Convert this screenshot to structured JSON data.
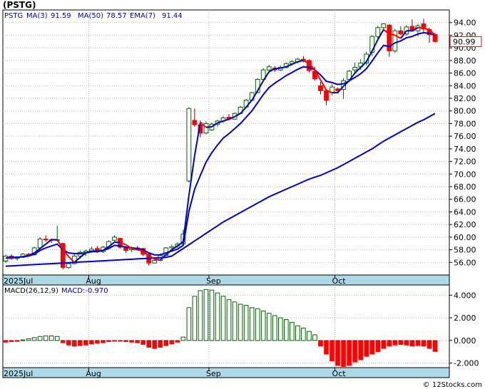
{
  "header": {
    "title": "(PSTG)"
  },
  "footer": {
    "credit": "© 12Stocks.com"
  },
  "colors": {
    "price_panel_bg": "#ffffff",
    "axis_strip": "#add8e6",
    "grid": "#b0b0b0",
    "candle_up": "#006400",
    "candle_down": "#ff0000",
    "ma_line": "#0000cc",
    "ema_line": "#ff0000",
    "macd_pos": "#006400",
    "macd_neg": "#ff0000",
    "price_box_border": "#ff0000"
  },
  "chart_data": [
    {
      "type": "candlestick",
      "legend": {
        "symbol": "PSTG",
        "ma3_label": "MA(3)",
        "ma3_value": "91.59",
        "ma50_label": "MA(50)",
        "ma50_value": "78.57",
        "ema7_label": "EMA(7)",
        "ema7_value": "91.44"
      },
      "last_price_label": "90.99",
      "ylim": [
        54,
        96
      ],
      "yticks": [
        "56.00",
        "58.00",
        "60.00",
        "62.00",
        "64.00",
        "66.00",
        "68.00",
        "70.00",
        "72.00",
        "74.00",
        "76.00",
        "78.00",
        "80.00",
        "82.00",
        "84.00",
        "86.00",
        "88.00",
        "90.00",
        "92.00",
        "94.00"
      ],
      "xticks": [
        {
          "label": "2025Jul",
          "index": 0
        },
        {
          "label": "Aug",
          "index": 15
        },
        {
          "label": "Sep",
          "index": 36
        },
        {
          "label": "Oct",
          "index": 58
        }
      ],
      "candles": [
        [
          56.2,
          57.2,
          55.9,
          57.0
        ],
        [
          57.0,
          57.3,
          56.4,
          56.6
        ],
        [
          56.6,
          57.0,
          56.3,
          56.8
        ],
        [
          56.8,
          57.5,
          56.7,
          57.3
        ],
        [
          57.3,
          57.5,
          56.9,
          57.1
        ],
        [
          57.2,
          58.5,
          57.1,
          58.3
        ],
        [
          58.3,
          60.0,
          58.1,
          59.7
        ],
        [
          59.7,
          60.3,
          59.3,
          59.6
        ],
        [
          59.6,
          59.8,
          59.1,
          59.5
        ],
        [
          59.5,
          61.8,
          59.3,
          59.6
        ],
        [
          59.0,
          59.1,
          54.9,
          55.2
        ],
        [
          55.2,
          56.0,
          55.0,
          55.8
        ],
        [
          55.8,
          57.4,
          55.7,
          57.0
        ],
        [
          57.0,
          57.9,
          56.6,
          57.6
        ],
        [
          57.6,
          58.0,
          57.0,
          57.8
        ],
        [
          57.8,
          58.5,
          57.5,
          58.1
        ],
        [
          58.2,
          58.6,
          57.5,
          57.7
        ],
        [
          57.7,
          58.6,
          57.5,
          58.4
        ],
        [
          58.4,
          59.5,
          58.2,
          59.3
        ],
        [
          59.5,
          60.3,
          59.3,
          60.0
        ],
        [
          59.8,
          59.9,
          58.2,
          58.4
        ],
        [
          58.4,
          58.6,
          57.5,
          57.9
        ],
        [
          58.0,
          58.5,
          57.6,
          58.2
        ],
        [
          58.3,
          58.6,
          57.9,
          58.0
        ],
        [
          58.2,
          58.3,
          57.0,
          57.3
        ],
        [
          57.3,
          57.4,
          55.5,
          55.9
        ],
        [
          55.9,
          56.5,
          55.8,
          56.3
        ],
        [
          56.3,
          57.4,
          56.2,
          57.1
        ],
        [
          57.1,
          58.4,
          57.0,
          58.3
        ],
        [
          58.3,
          58.8,
          58.1,
          58.5
        ],
        [
          58.6,
          59.2,
          58.3,
          58.9
        ],
        [
          58.9,
          61.2,
          58.8,
          60.5
        ],
        [
          68.9,
          80.6,
          68.7,
          80.4
        ],
        [
          78.5,
          80.4,
          77.5,
          77.8
        ],
        [
          77.8,
          78.5,
          75.8,
          76.5
        ],
        [
          76.5,
          78.4,
          76.3,
          78.0
        ],
        [
          77.0,
          78.2,
          76.8,
          77.9
        ],
        [
          77.9,
          78.6,
          77.5,
          78.4
        ],
        [
          78.4,
          79.2,
          78.1,
          78.9
        ],
        [
          79.0,
          79.5,
          78.5,
          78.7
        ],
        [
          78.7,
          79.8,
          78.6,
          79.6
        ],
        [
          79.6,
          80.8,
          79.5,
          80.6
        ],
        [
          80.6,
          81.9,
          80.5,
          81.7
        ],
        [
          81.7,
          83.0,
          81.6,
          82.9
        ],
        [
          82.9,
          85.2,
          82.8,
          85.0
        ],
        [
          85.0,
          86.8,
          84.7,
          86.5
        ],
        [
          86.5,
          87.3,
          86.2,
          87.0
        ],
        [
          86.8,
          87.1,
          86.2,
          86.5
        ],
        [
          86.5,
          87.2,
          86.3,
          86.9
        ],
        [
          86.9,
          87.7,
          86.7,
          87.5
        ],
        [
          87.5,
          88.1,
          87.2,
          87.8
        ],
        [
          87.8,
          88.4,
          87.5,
          88.2
        ],
        [
          88.2,
          88.7,
          87.7,
          88.0
        ],
        [
          88.0,
          88.2,
          86.1,
          86.4
        ],
        [
          86.3,
          87.0,
          84.8,
          85.1
        ],
        [
          84.0,
          84.6,
          82.6,
          83.2
        ],
        [
          83.2,
          83.5,
          80.9,
          81.7
        ],
        [
          82.9,
          84.2,
          82.5,
          83.8
        ],
        [
          83.5,
          83.7,
          82.8,
          83.2
        ],
        [
          83.4,
          85.2,
          81.9,
          84.8
        ],
        [
          85.0,
          86.5,
          84.6,
          86.3
        ],
        [
          86.5,
          87.7,
          85.9,
          86.9
        ],
        [
          87.0,
          88.2,
          86.5,
          87.6
        ],
        [
          87.6,
          89.4,
          87.2,
          89.0
        ],
        [
          89.3,
          92.0,
          88.7,
          91.8
        ],
        [
          91.8,
          93.5,
          91.2,
          93.2
        ],
        [
          93.2,
          93.9,
          92.6,
          93.8
        ],
        [
          93.6,
          93.8,
          88.6,
          89.5
        ],
        [
          89.5,
          93.0,
          89.2,
          92.7
        ],
        [
          92.7,
          93.4,
          92.0,
          92.2
        ],
        [
          92.2,
          93.6,
          91.9,
          93.3
        ],
        [
          93.4,
          94.5,
          92.5,
          92.7
        ],
        [
          92.7,
          93.8,
          91.8,
          93.5
        ],
        [
          93.8,
          94.6,
          92.5,
          93.0
        ],
        [
          92.9,
          93.2,
          90.8,
          92.1
        ],
        [
          92.1,
          92.4,
          90.9,
          91.0
        ]
      ],
      "ma3": [
        56.7,
        56.8,
        56.8,
        56.9,
        57.1,
        57.5,
        58.2,
        58.9,
        59.6,
        59.6,
        58.1,
        56.9,
        56.0,
        56.8,
        57.5,
        57.8,
        57.8,
        57.9,
        58.5,
        59.2,
        59.2,
        58.8,
        58.2,
        58.0,
        57.8,
        57.1,
        56.5,
        56.4,
        57.2,
        58.0,
        58.6,
        59.3,
        66.6,
        72.9,
        78.2,
        77.4,
        77.5,
        78.1,
        78.4,
        78.7,
        79.1,
        79.6,
        80.6,
        81.7,
        83.2,
        84.8,
        86.2,
        86.7,
        86.8,
        87.0,
        87.4,
        87.8,
        88.0,
        87.5,
        86.5,
        84.9,
        83.3,
        82.9,
        82.9,
        83.9,
        84.8,
        86.0,
        86.9,
        87.8,
        89.5,
        91.3,
        92.9,
        92.2,
        92.0,
        91.5,
        92.7,
        92.7,
        93.2,
        93.1,
        92.9,
        92.0
      ],
      "ema7": [
        56.7,
        56.8,
        56.8,
        56.9,
        57.0,
        57.3,
        57.9,
        58.3,
        58.6,
        58.9,
        58.0,
        57.5,
        57.4,
        57.4,
        57.5,
        57.7,
        57.7,
        57.9,
        58.2,
        58.7,
        58.6,
        58.4,
        58.3,
        58.2,
        58.0,
        57.5,
        57.2,
        57.2,
        57.5,
        57.8,
        58.1,
        58.7,
        64.1,
        67.6,
        69.8,
        71.9,
        73.4,
        74.6,
        75.7,
        76.4,
        77.2,
        78.0,
        79.0,
        80.0,
        81.3,
        82.6,
        83.7,
        84.4,
        85.0,
        85.6,
        86.1,
        86.6,
        87.0,
        86.9,
        86.5,
        85.7,
        84.7,
        84.5,
        84.2,
        84.3,
        84.8,
        85.3,
        85.9,
        86.7,
        87.9,
        89.2,
        90.4,
        90.2,
        90.8,
        91.1,
        91.6,
        91.8,
        92.2,
        92.4,
        92.3,
        92.0
      ],
      "ma50": [
        55.4,
        55.45,
        55.5,
        55.55,
        55.6,
        55.65,
        55.7,
        55.75,
        55.8,
        55.85,
        55.9,
        55.95,
        56.0,
        56.05,
        56.1,
        56.15,
        56.2,
        56.25,
        56.3,
        56.35,
        56.4,
        56.45,
        56.5,
        56.55,
        56.6,
        56.65,
        56.7,
        56.75,
        56.8,
        57.0,
        57.6,
        58.2,
        58.8,
        59.4,
        60.0,
        60.6,
        61.2,
        61.8,
        62.4,
        62.9,
        63.4,
        63.9,
        64.4,
        64.9,
        65.4,
        65.9,
        66.4,
        66.8,
        67.2,
        67.6,
        68.0,
        68.4,
        68.8,
        69.2,
        69.5,
        69.8,
        70.2,
        70.6,
        71.0,
        71.5,
        72.0,
        72.5,
        73.0,
        73.5,
        74.0,
        74.6,
        75.2,
        75.7,
        76.2,
        76.7,
        77.2,
        77.7,
        78.2,
        78.6,
        79.1,
        79.6
      ]
    },
    {
      "type": "bar",
      "legend": {
        "label": "MACD(26,12,9)",
        "value_label": "MACD:-0.970"
      },
      "ylim": [
        -2.4,
        4.9
      ],
      "yticks": [
        "-2.000",
        "0.000",
        "2.000",
        "4.000"
      ],
      "values": [
        -0.15,
        -0.1,
        -0.08,
        0.05,
        0.15,
        0.25,
        0.35,
        0.4,
        0.4,
        0.35,
        -0.2,
        -0.4,
        -0.5,
        -0.45,
        -0.4,
        -0.3,
        -0.25,
        -0.2,
        -0.1,
        -0.05,
        -0.05,
        -0.1,
        -0.15,
        -0.2,
        -0.35,
        -0.6,
        -0.7,
        -0.6,
        -0.45,
        -0.3,
        -0.15,
        0.3,
        2.9,
        3.9,
        4.4,
        4.5,
        4.45,
        4.2,
        3.9,
        3.6,
        3.4,
        3.2,
        3.1,
        2.9,
        2.8,
        2.6,
        2.4,
        2.2,
        2.0,
        1.85,
        1.6,
        1.3,
        1.1,
        0.8,
        0.5,
        -0.5,
        -1.2,
        -1.8,
        -2.2,
        -2.3,
        -2.2,
        -1.9,
        -1.7,
        -1.4,
        -1.2,
        -1.0,
        -0.7,
        -0.5,
        -0.4,
        -0.35,
        -0.4,
        -0.5,
        -0.45,
        -0.5,
        -0.7,
        -0.97
      ],
      "xticks": [
        {
          "label": "2025Jul",
          "index": 0
        },
        {
          "label": "Aug",
          "index": 15
        },
        {
          "label": "Sep",
          "index": 36
        },
        {
          "label": "Oct",
          "index": 58
        }
      ]
    }
  ]
}
